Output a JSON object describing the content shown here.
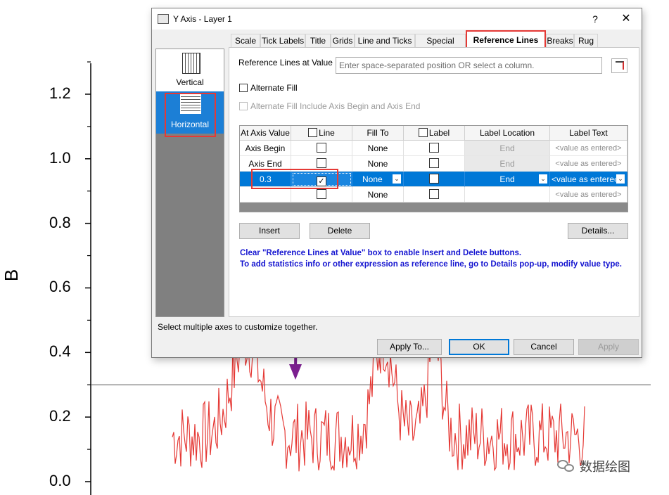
{
  "plot": {
    "ylabel": "B",
    "yticks": [
      "0.0",
      "0.2",
      "0.4",
      "0.6",
      "0.8",
      "1.0",
      "1.2"
    ],
    "reference_line_value": 0.3,
    "line_color": "#e53935",
    "watermark": "数据绘图"
  },
  "dialog": {
    "title": "Y Axis - Layer 1",
    "help_label": "?",
    "close_label": "✕",
    "tabs": [
      "Scale",
      "Tick Labels",
      "Title",
      "Grids",
      "Line and Ticks",
      "Special Ticks",
      "Reference Lines",
      "Breaks",
      "Rug"
    ],
    "active_tab": "Reference Lines",
    "sidebar": {
      "vertical_label": "Vertical",
      "horizontal_label": "Horizontal"
    },
    "ref_lines_label": "Reference Lines at Value",
    "ref_lines_placeholder": "Enter space-separated position OR select a column.",
    "alternate_fill": "Alternate Fill",
    "alternate_fill_include": "Alternate Fill Include Axis Begin and Axis End",
    "grid": {
      "headers": [
        "At Axis Value",
        "Line",
        "Fill To",
        "Label",
        "Label Location",
        "Label Text"
      ],
      "rows": [
        {
          "value": "Axis Begin",
          "line": false,
          "fill_to": "None",
          "label": false,
          "location": "End",
          "text": "<value as entered>"
        },
        {
          "value": "Axis End",
          "line": false,
          "fill_to": "None",
          "label": false,
          "location": "End",
          "text": "<value as entered>"
        },
        {
          "value": "0.3",
          "line": true,
          "fill_to": "None",
          "label": false,
          "location": "End",
          "text": "<value as entered>"
        },
        {
          "value": "",
          "line": false,
          "fill_to": "None",
          "label": false,
          "location": "",
          "text": "<value as entered>"
        }
      ]
    },
    "insert_label": "Insert",
    "delete_label": "Delete",
    "details_label": "Details...",
    "info_line1": "Clear \"Reference Lines at Value\" box to enable Insert and Delete buttons.",
    "info_line2": "To add statistics info or other expression as reference line, go to Details pop-up, modify value type.",
    "status": "Select multiple axes to customize together.",
    "apply_to_label": "Apply To...",
    "ok_label": "OK",
    "cancel_label": "Cancel",
    "apply_label": "Apply",
    "highlight_color": "#e53935",
    "arrow_color": "#7b1f8f"
  }
}
